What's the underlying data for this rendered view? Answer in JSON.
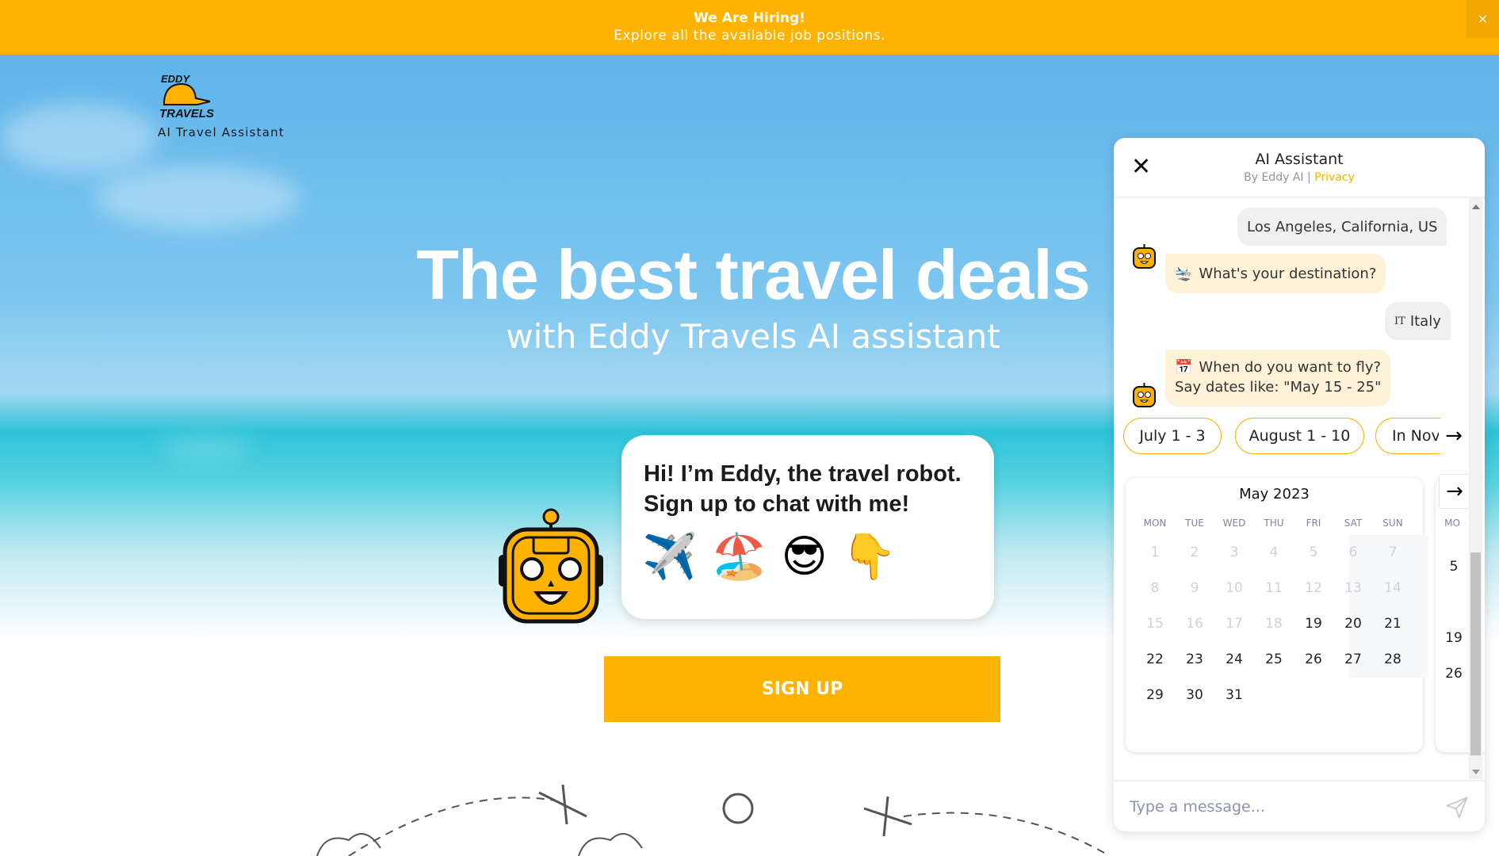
{
  "banner": {
    "title": "We Are Hiring!",
    "subtitle": "Explore all the available job positions.",
    "close_label": "×"
  },
  "brand": {
    "logo_text": "EDDY TRAVELS",
    "tagline": "AI Travel Assistant"
  },
  "hero": {
    "title": "The best travel deals",
    "subtitle": "with Eddy Travels AI assistant",
    "bubble_line1": "Hi! I’m Eddy, the travel robot.",
    "bubble_line2": "Sign up to chat with me!",
    "emojis": "✈️🏖️😎👇",
    "signup_label": "SIGN UP"
  },
  "chat": {
    "title": "AI Assistant",
    "by": "By Eddy AI",
    "separator": "|",
    "privacy": "Privacy",
    "close_label": "✕",
    "messages": [
      {
        "from": "user",
        "text": "Los Angeles, California, US"
      },
      {
        "from": "bot",
        "icon": "🛬",
        "text": "What's your destination?"
      },
      {
        "from": "user",
        "icon": "IT",
        "text": "Italy"
      },
      {
        "from": "bot",
        "icon": "📅",
        "text": "When do you want to fly?",
        "text2": "Say dates like: \"May 15 - 25\""
      }
    ],
    "chips": [
      "July 1 - 3",
      "August 1 - 10",
      "In Nov"
    ],
    "calendar": {
      "month": "May 2023",
      "weekdays": [
        "MON",
        "TUE",
        "WED",
        "THU",
        "FRI",
        "SAT",
        "SUN"
      ],
      "first_available": 19,
      "days_in_month": 31,
      "first_weekday_index": 0,
      "next_month_weekday": "MO",
      "next_month_days": [
        "5",
        "19",
        "26"
      ]
    },
    "input_placeholder": "Type a message...",
    "accent": "#ffb200"
  }
}
